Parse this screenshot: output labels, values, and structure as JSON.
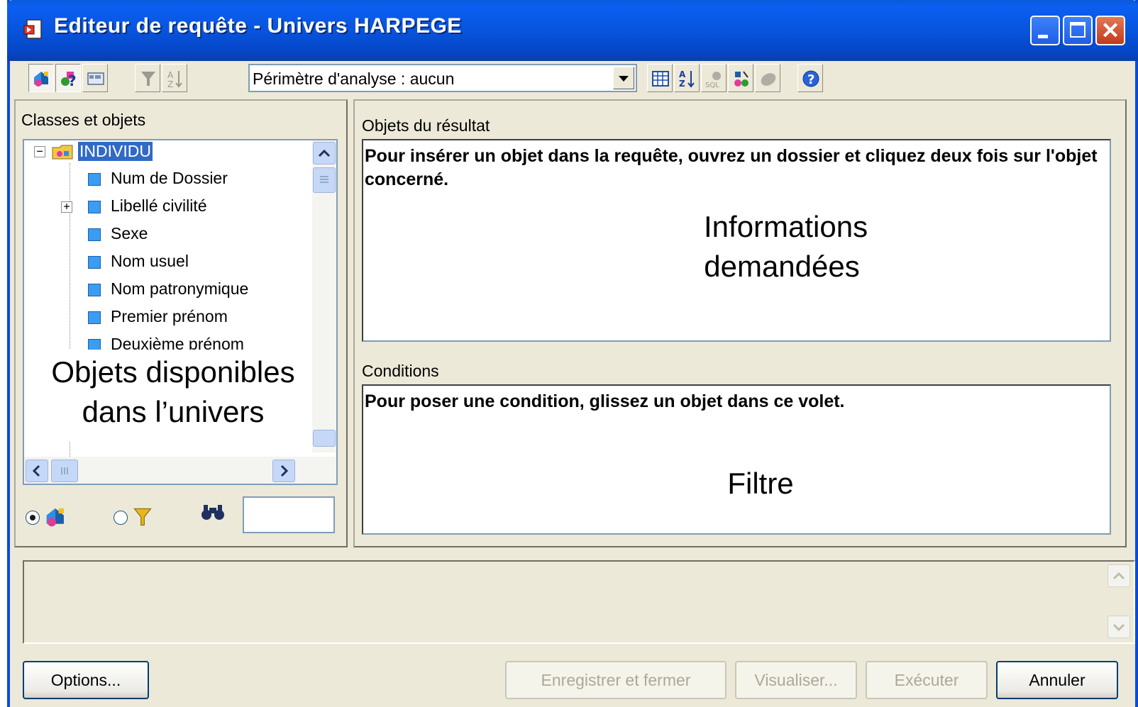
{
  "window": {
    "title": "Editeur de requête - Univers HARPEGE"
  },
  "toolbar": {
    "scope_combo_value": "Périmètre d'analyse : aucun"
  },
  "left_panel": {
    "heading": "Classes et objets",
    "tree": {
      "root": "INDIVIDU",
      "items": [
        "Num de Dossier",
        "Libellé civilité",
        "Sexe",
        "Nom usuel",
        "Nom patronymique",
        "Premier prénom",
        "Deuxième prénom"
      ]
    },
    "overlay": {
      "line1": "Objets disponibles",
      "line2": "dans l’univers"
    }
  },
  "result_section": {
    "label": "Objets du résultat",
    "hint": "Pour insérer un objet dans la requête, ouvrez un dossier et cliquez deux fois sur l'objet concerné.",
    "overlay_line1": "Informations",
    "overlay_line2": "demandées"
  },
  "conditions_section": {
    "label": "Conditions",
    "hint": "Pour poser une condition, glissez un objet dans ce volet.",
    "overlay": "Filtre"
  },
  "buttons": {
    "options": "Options...",
    "save_close": "Enregistrer et fermer",
    "preview": "Visualiser...",
    "execute": "Exécuter",
    "cancel": "Annuler"
  },
  "colors": {
    "titlebar_blue": "#0856e0",
    "selection_blue": "#316ac5",
    "window_bg": "#ece9d8",
    "close_red": "#c13a1a"
  }
}
